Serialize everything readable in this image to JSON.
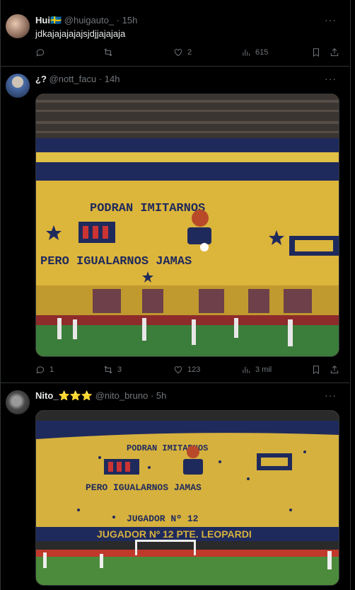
{
  "tweets": [
    {
      "name": "Hui🇸🇪",
      "handle": "@huigauto_",
      "time": "15h",
      "text": "jdkajajajajajsjdjjajajaja",
      "replies": "",
      "retweets": "",
      "likes": "2",
      "views": "615"
    },
    {
      "name": "¿?",
      "handle": "@nott_facu",
      "time": "14h",
      "media_text": [
        "PODRAN IMITARNOS",
        "PERO IGUALARNOS JAMAS"
      ],
      "replies": "1",
      "retweets": "3",
      "likes": "123",
      "views": "3 mil"
    },
    {
      "name": "Nito_⭐⭐⭐",
      "handle": "@nito_bruno",
      "time": "5h",
      "media_text": [
        "PODRAN IMITARNOS",
        "PERO IGUALARNOS JAMAS",
        "JUGADOR Nº 12",
        "JUGADOR Nº 12 PTE. LEOPARDI"
      ]
    }
  ],
  "colors": {
    "background": "#000000",
    "muted": "#71767b",
    "banner_yellow": "#d9b33a",
    "banner_blue": "#1f2a5c",
    "pitch": "#3b7d3a"
  },
  "separator": "·",
  "more_glyph": "···"
}
